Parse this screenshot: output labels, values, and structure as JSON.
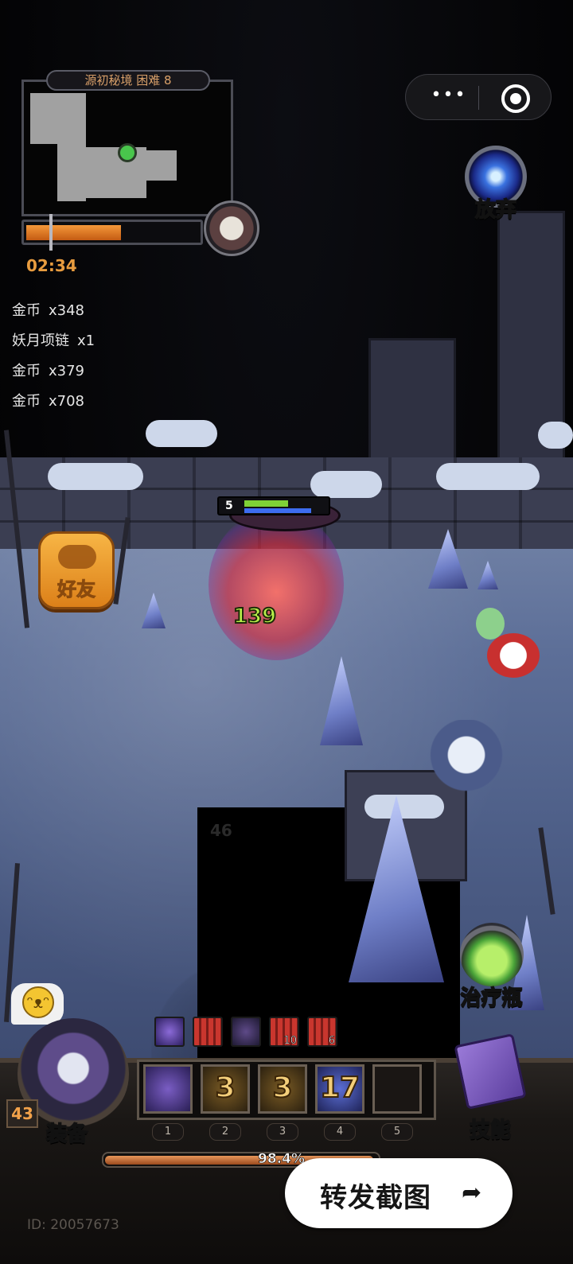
{
  "minimap": {
    "title": "源初秘境 困难 8"
  },
  "timer": "02:34",
  "progress": {
    "time_fraction": 0.55
  },
  "loot": [
    {
      "name": "金币",
      "qty": "x348"
    },
    {
      "name": "妖月项链",
      "qty": "x1"
    },
    {
      "name": "金币",
      "qty": "x379"
    },
    {
      "name": "金币",
      "qty": "x708"
    }
  ],
  "buttons": {
    "abandon": "放弃",
    "friend": "好友",
    "potion": "治疗瓶",
    "equip": "装备",
    "skill": "技能",
    "share": "转发截图"
  },
  "hero": {
    "level": "5",
    "damage": "139",
    "hp_fraction": 0.55,
    "mp_fraction": 0.84
  },
  "floor_number": "46",
  "buffs": [
    {
      "icon": "purple-crystal-buff-icon",
      "stack": ""
    },
    {
      "icon": "red-pillar-buff-icon",
      "stack": ""
    },
    {
      "icon": "dark-claw-buff-icon",
      "stack": ""
    },
    {
      "icon": "red-pillar-buff-icon",
      "stack": "10"
    },
    {
      "icon": "red-pillar-buff-icon",
      "stack": "6"
    }
  ],
  "skill_slots": [
    {
      "num": "1",
      "count": "",
      "icon": "slash-skill-icon"
    },
    {
      "num": "2",
      "count": "3",
      "icon": "gold-skill-icon"
    },
    {
      "num": "3",
      "count": "3",
      "icon": "gold-skill-icon"
    },
    {
      "num": "4",
      "count": "17",
      "icon": "blue-skill-icon"
    },
    {
      "num": "5",
      "count": "",
      "icon": "empty-slot"
    }
  ],
  "player_level": "43",
  "xp": {
    "text": "98.4%",
    "fraction": 0.984
  },
  "id_text": "ID: 20057673",
  "colors": {
    "timer": "#e89c3f",
    "minimap_title": "#d9a069",
    "damage": "#b8f04a",
    "level_badge": "#f2a24a"
  }
}
